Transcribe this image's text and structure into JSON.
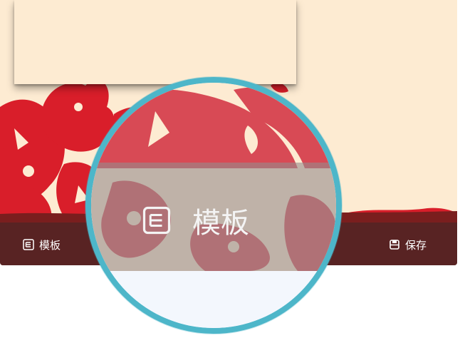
{
  "bottom_bar": {
    "template_label": "模板",
    "save_label": "保存"
  },
  "magnifier": {
    "template_label": "模板"
  },
  "colors": {
    "background": "#fdebd2",
    "papercut_red": "#d91e2a",
    "ring": "#4db6c9"
  },
  "icons": {
    "template": "template-icon",
    "save": "save-icon"
  }
}
